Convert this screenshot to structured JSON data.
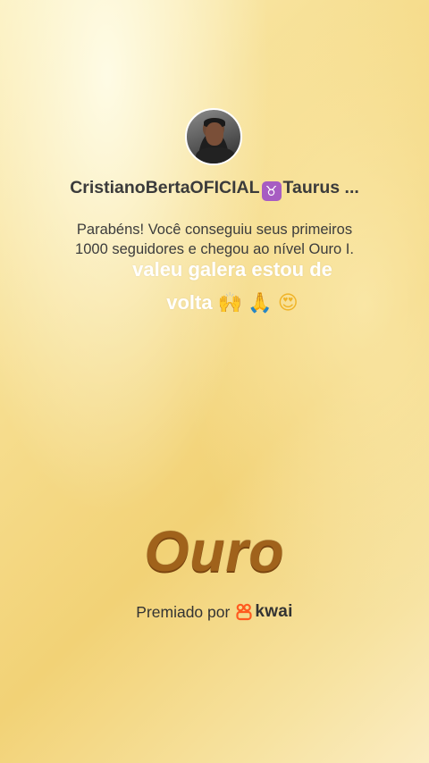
{
  "profile": {
    "username": "CristianoBertaOFICIAL",
    "zodiac_icon": "taurus-icon",
    "zodiac_glyph": "♉",
    "zodiac_label": "Taurus ...",
    "message_line1": "Parabéns! Você conseguiu seus primeiros",
    "message_line2": "1000 seguidores e chegou ao nível Ouro I."
  },
  "caption": {
    "line1": "valeu galera estou de",
    "line2": "volta",
    "emojis": [
      "raising-hands-emoji",
      "folded-hands-emoji",
      "heart-eyes-emoji"
    ],
    "emoji_glyphs": [
      "🙌",
      "🙏",
      "😍"
    ]
  },
  "level": {
    "title": "Ouro"
  },
  "award": {
    "label": "Premiado por",
    "brand": "kwai",
    "brand_color": "#ff5a1f"
  },
  "colors": {
    "background": "#f6dd8e",
    "title": "#a0621b",
    "zodiac_badge": "#a75cc2"
  }
}
